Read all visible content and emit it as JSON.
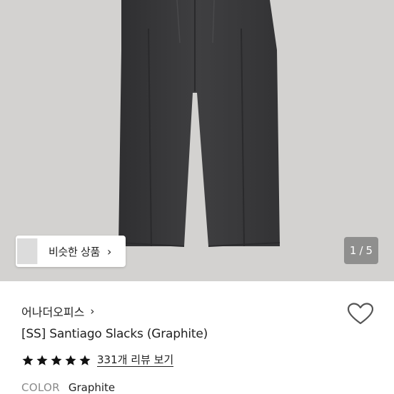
{
  "gallery": {
    "similar_button_label": "비슷한 상품",
    "similar_chevron": "›",
    "pager_current": "1",
    "pager_separator": "/",
    "pager_total": "5"
  },
  "product": {
    "brand": "어나더오피스",
    "brand_chevron": "›",
    "title": "[SS] Santiago Slacks (Graphite)",
    "rating_stars": 5,
    "review_link": "331개 리뷰 보기",
    "color_label": "COLOR",
    "color_value": "Graphite"
  },
  "colors": {
    "hero_background": "#d3d2d0",
    "pants": "#3b3b3d",
    "text": "#222222",
    "muted": "#8a8a8a"
  }
}
